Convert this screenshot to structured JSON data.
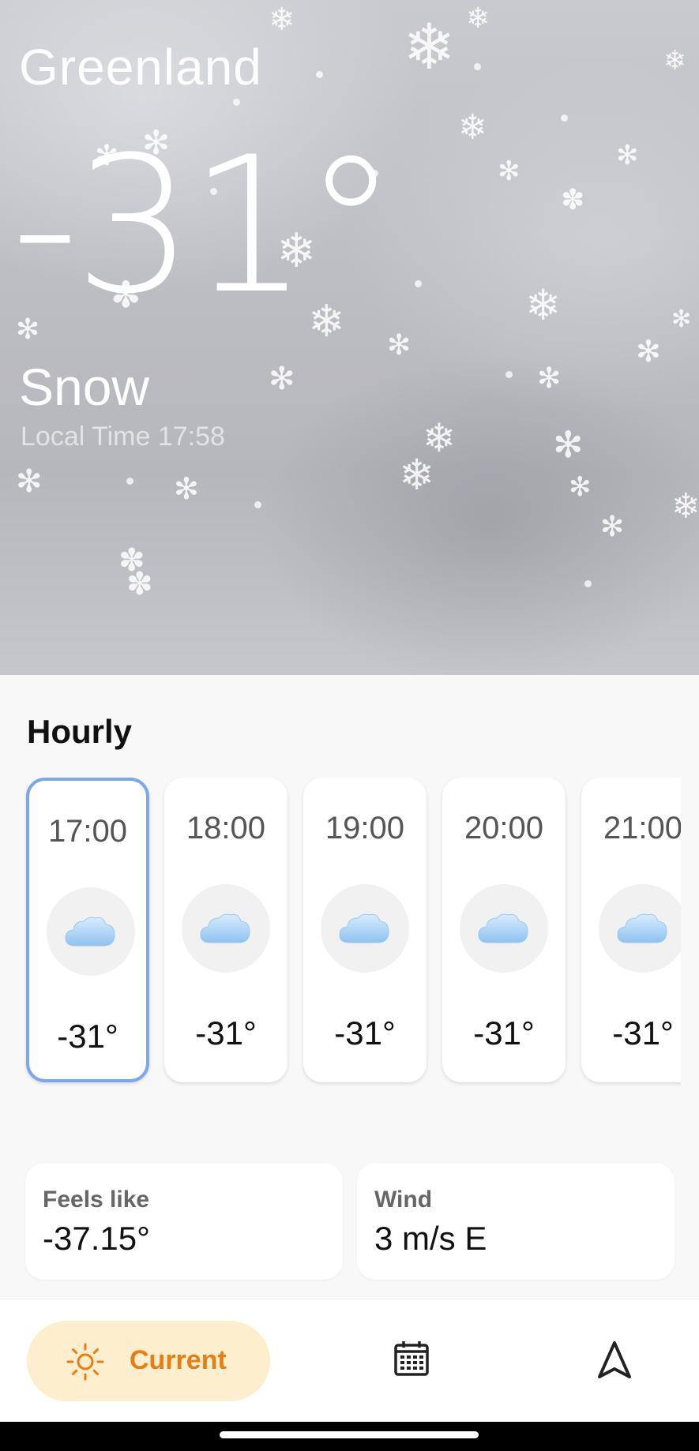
{
  "current": {
    "location": "Greenland",
    "temperature": "-31°",
    "condition": "Snow",
    "local_time": "Local Time 17:58"
  },
  "hourly": {
    "title": "Hourly",
    "selected_index": 0,
    "icon": "cloud-icon",
    "items": [
      {
        "time": "17:00",
        "temp": "-31°"
      },
      {
        "time": "18:00",
        "temp": "-31°"
      },
      {
        "time": "19:00",
        "temp": "-31°"
      },
      {
        "time": "20:00",
        "temp": "-31°"
      },
      {
        "time": "21:00",
        "temp": "-31°"
      }
    ]
  },
  "details": {
    "feels_like": {
      "label": "Feels like",
      "value": "-37.15°"
    },
    "wind": {
      "label": "Wind",
      "value": "3 m/s E"
    }
  },
  "nav": {
    "current_label": "Current",
    "current_icon": "sun-icon",
    "calendar_icon": "calendar-icon",
    "location_icon": "navigation-arrow-icon"
  },
  "colors": {
    "accent_orange": "#e67e14",
    "pill_bg": "#fdefce",
    "selected_border": "#7ea6ee"
  }
}
